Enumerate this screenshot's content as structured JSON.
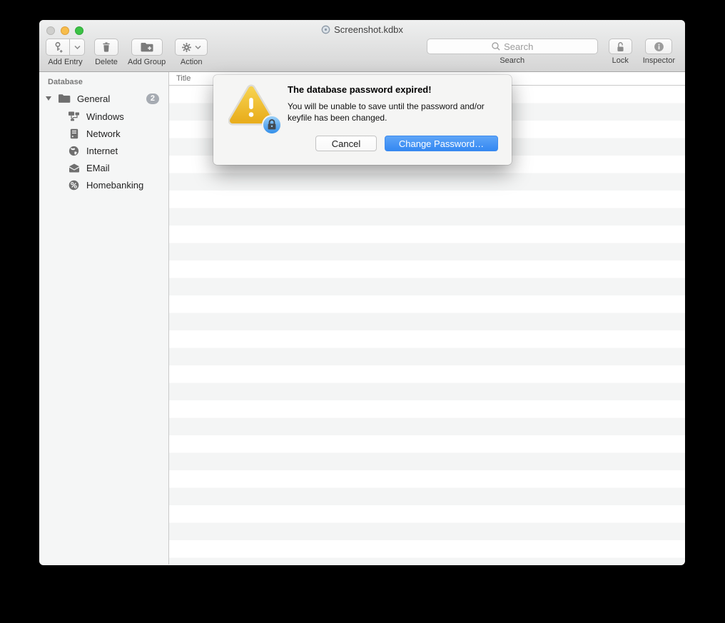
{
  "window": {
    "title": "Screenshot.kdbx"
  },
  "toolbar": {
    "add_entry": {
      "label": "Add Entry",
      "icon": "key-plus-icon"
    },
    "delete": {
      "label": "Delete",
      "icon": "trash-icon"
    },
    "add_group": {
      "label": "Add Group",
      "icon": "folder-plus-icon"
    },
    "action": {
      "label": "Action",
      "icon": "gear-icon"
    },
    "search": {
      "placeholder": "Search",
      "label": "Search",
      "icon": "magnifier-icon"
    },
    "lock": {
      "label": "Lock",
      "icon": "open-padlock-icon"
    },
    "inspector": {
      "label": "Inspector",
      "icon": "info-icon"
    }
  },
  "sidebar": {
    "header": "Database",
    "root": {
      "label": "General",
      "badge": "2",
      "icon": "folder-icon"
    },
    "items": [
      {
        "label": "Windows",
        "icon": "network-computers-icon"
      },
      {
        "label": "Network",
        "icon": "server-icon"
      },
      {
        "label": "Internet",
        "icon": "globe-icon"
      },
      {
        "label": "EMail",
        "icon": "envelope-icon"
      },
      {
        "label": "Homebanking",
        "icon": "percent-icon"
      }
    ]
  },
  "main": {
    "columns": [
      {
        "label": "Title"
      }
    ]
  },
  "dialog": {
    "title": "The database password expired!",
    "body": "You will be unable to save until the password and/or\nkeyfile has been changed.",
    "cancel_label": "Cancel",
    "confirm_label": "Change Password…",
    "icon": "warning-triangle-lock-icon"
  },
  "colors": {
    "accent_blue": "#4795f4",
    "warning_gold": "#eebb2d",
    "badge_gray": "#a6abb2"
  }
}
